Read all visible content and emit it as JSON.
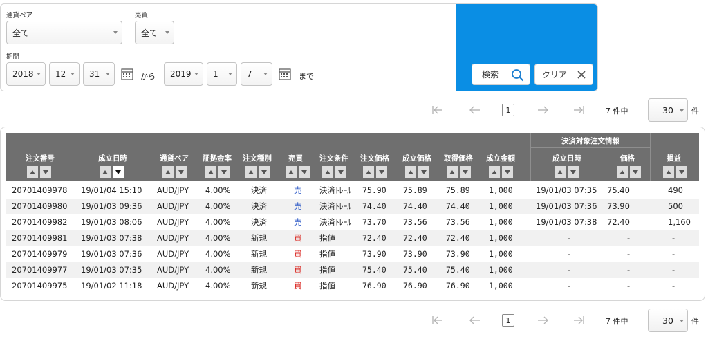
{
  "filters": {
    "pair_label": "通貨ペア",
    "pair_value": "全て",
    "side_label": "売買",
    "side_value": "全て",
    "period_label": "期間",
    "from": {
      "year": "2018",
      "month": "12",
      "day": "31"
    },
    "from_word": "から",
    "to": {
      "year": "2019",
      "month": "1",
      "day": "7"
    },
    "to_word": "まで",
    "search_label": "検索",
    "clear_label": "クリア"
  },
  "pager": {
    "current_page": "1",
    "count_text": "7 件中",
    "page_size": "30",
    "unit": "件"
  },
  "table": {
    "group_header": "決済対象注文情報",
    "columns": {
      "order_no": "注文番号",
      "exec_time": "成立日時",
      "pair": "通貨ペア",
      "margin_rate": "証拠金率",
      "order_type": "注文種別",
      "side": "売買",
      "condition": "注文条件",
      "order_price": "注文価格",
      "exec_price": "成立価格",
      "acq_price": "取得価格",
      "exec_amount": "成立金額",
      "settle_time": "成立日時",
      "settle_price": "価格",
      "pnl": "損益"
    },
    "rows": [
      {
        "order_no": "20701409978",
        "exec_time": "19/01/04 15:10",
        "pair": "AUD/JPY",
        "margin_rate": "4.00%",
        "order_type": "決済",
        "side": "売",
        "condition": "決済ﾄﾚｰﾙ",
        "order_price": "75.90",
        "exec_price": "75.89",
        "acq_price": "75.89",
        "exec_amount": "1,000",
        "settle_time": "19/01/03 07:35",
        "settle_price": "75.40",
        "pnl": "490"
      },
      {
        "order_no": "20701409980",
        "exec_time": "19/01/03 09:36",
        "pair": "AUD/JPY",
        "margin_rate": "4.00%",
        "order_type": "決済",
        "side": "売",
        "condition": "決済ﾄﾚｰﾙ",
        "order_price": "74.40",
        "exec_price": "74.40",
        "acq_price": "74.40",
        "exec_amount": "1,000",
        "settle_time": "19/01/03 07:36",
        "settle_price": "73.90",
        "pnl": "500"
      },
      {
        "order_no": "20701409982",
        "exec_time": "19/01/03 08:06",
        "pair": "AUD/JPY",
        "margin_rate": "4.00%",
        "order_type": "決済",
        "side": "売",
        "condition": "決済ﾄﾚｰﾙ",
        "order_price": "73.70",
        "exec_price": "73.56",
        "acq_price": "73.56",
        "exec_amount": "1,000",
        "settle_time": "19/01/03 07:38",
        "settle_price": "72.40",
        "pnl": "1,160"
      },
      {
        "order_no": "20701409981",
        "exec_time": "19/01/03 07:38",
        "pair": "AUD/JPY",
        "margin_rate": "4.00%",
        "order_type": "新規",
        "side": "買",
        "condition": "指値",
        "order_price": "72.40",
        "exec_price": "72.40",
        "acq_price": "72.40",
        "exec_amount": "1,000",
        "settle_time": "-",
        "settle_price": "-",
        "pnl": "-"
      },
      {
        "order_no": "20701409979",
        "exec_time": "19/01/03 07:36",
        "pair": "AUD/JPY",
        "margin_rate": "4.00%",
        "order_type": "新規",
        "side": "買",
        "condition": "指値",
        "order_price": "73.90",
        "exec_price": "73.90",
        "acq_price": "73.90",
        "exec_amount": "1,000",
        "settle_time": "-",
        "settle_price": "-",
        "pnl": "-"
      },
      {
        "order_no": "20701409977",
        "exec_time": "19/01/03 07:35",
        "pair": "AUD/JPY",
        "margin_rate": "4.00%",
        "order_type": "新規",
        "side": "買",
        "condition": "指値",
        "order_price": "75.40",
        "exec_price": "75.40",
        "acq_price": "75.40",
        "exec_amount": "1,000",
        "settle_time": "-",
        "settle_price": "-",
        "pnl": "-"
      },
      {
        "order_no": "20701409975",
        "exec_time": "19/01/02 11:18",
        "pair": "AUD/JPY",
        "margin_rate": "4.00%",
        "order_type": "新規",
        "side": "買",
        "condition": "指値",
        "order_price": "76.90",
        "exec_price": "76.90",
        "acq_price": "76.90",
        "exec_amount": "1,000",
        "settle_time": "-",
        "settle_price": "-",
        "pnl": "-"
      }
    ]
  },
  "colors": {
    "accent_blue": "#0a8ee4",
    "sell": "#2a57c6",
    "buy": "#d9221c",
    "header_gray": "#6f6f6f"
  }
}
